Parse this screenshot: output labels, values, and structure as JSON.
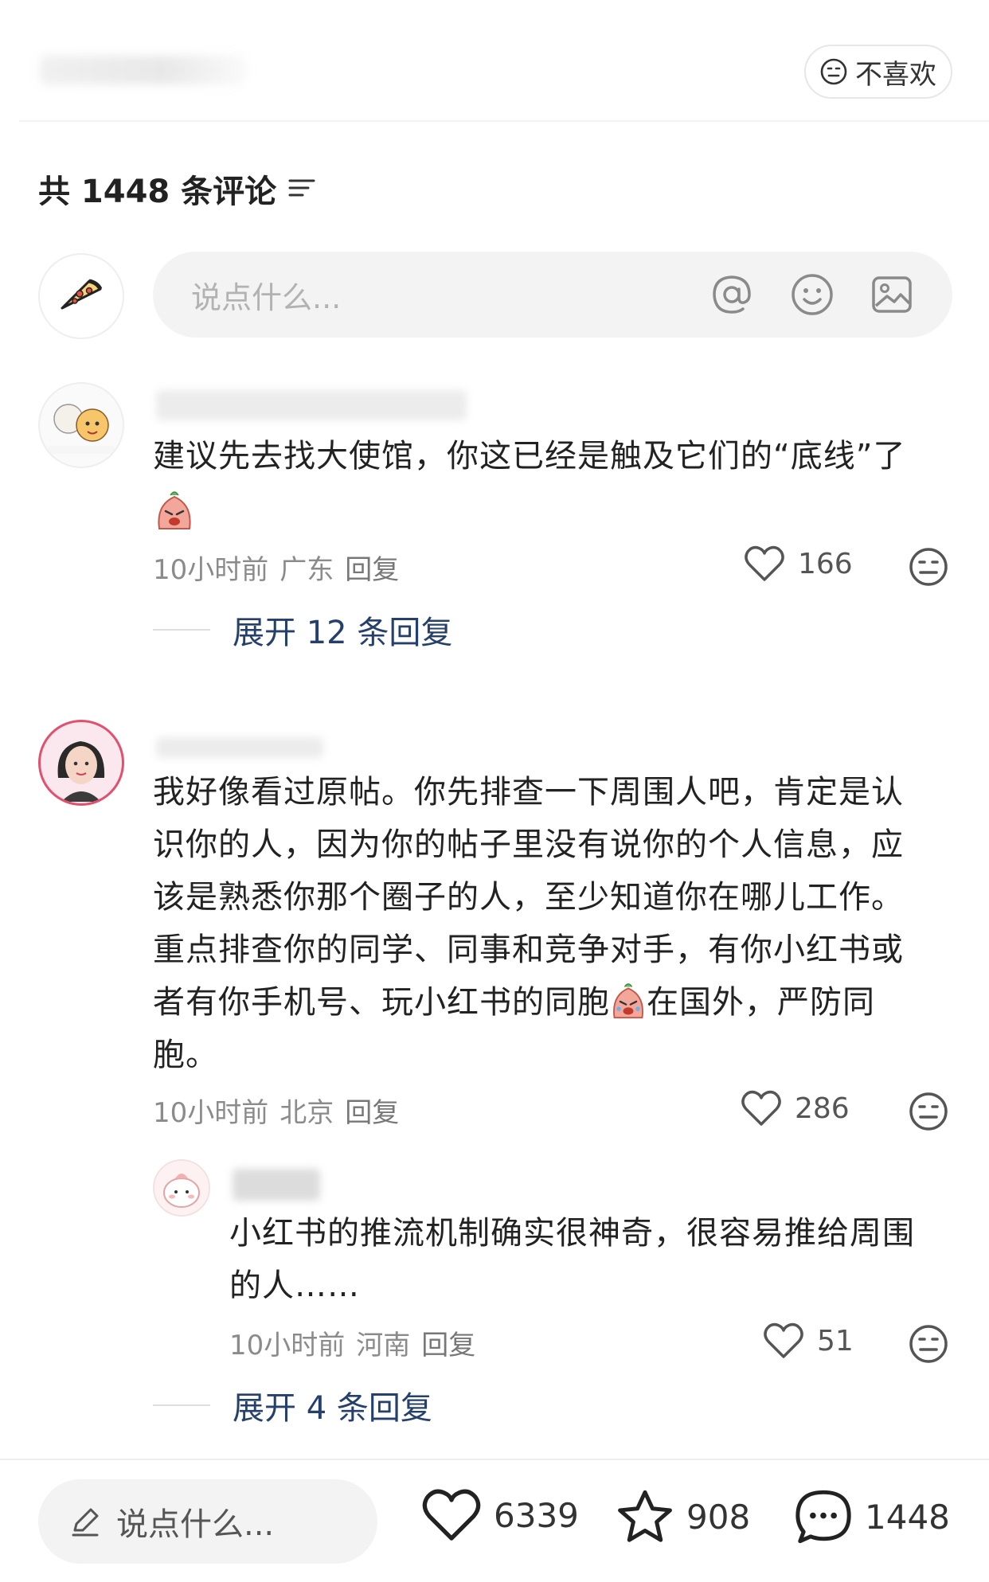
{
  "header": {
    "dislike_label": "不喜欢"
  },
  "comments_header": {
    "title": "共 1448 条评论"
  },
  "composer": {
    "placeholder": "说点什么..."
  },
  "comments": [
    {
      "text": "建议先去找大使馆，你这已经是触及它们的“底线”了",
      "time": "10小时前",
      "location": "广东",
      "reply_label": "回复",
      "likes": "166",
      "expand_label": "展开 12 条回复"
    },
    {
      "text_lines": [
        "我好像看过原帖。你先排查一下周围人吧，肯定是认",
        "识你的人，因为你的帖子里没有说你的个人信息，应",
        "该是熟悉你那个圈子的人，至少知道你在哪儿工作。",
        "重点排查你的同学、同事和竞争对手，有你小红书或",
        "者有你手机号、玩小红书的同胞",
        "在国外，严防同",
        "胞。"
      ],
      "time": "10小时前",
      "location": "北京",
      "reply_label": "回复",
      "likes": "286",
      "reply": {
        "text_lines": [
          "小红书的推流机制确实很神奇，很容易推给周围",
          "的人……"
        ],
        "time": "10小时前",
        "location": "河南",
        "reply_label": "回复",
        "likes": "51"
      },
      "expand_label": "展开 4 条回复"
    }
  ],
  "bottom_bar": {
    "input_placeholder": "说点什么...",
    "likes": "6339",
    "favorites": "908",
    "comments": "1448"
  },
  "colors": {
    "link": "#25406b",
    "meta": "#8b8b8b",
    "input_bg": "#f3f3f3"
  }
}
